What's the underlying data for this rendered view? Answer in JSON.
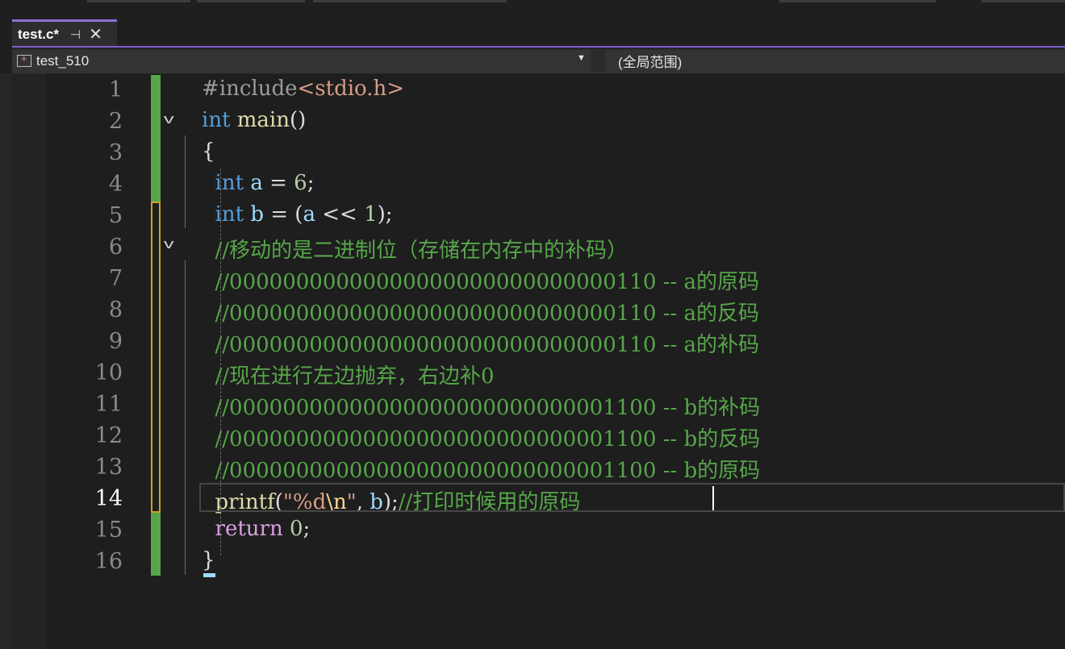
{
  "tab": {
    "title": "test.c*",
    "pin_icon": "⊣",
    "close_icon": "✕"
  },
  "nav": {
    "project": "test_510",
    "scope": "(全局范围)",
    "dropdown_icon": "▼"
  },
  "editor": {
    "current_line": 14,
    "lines": [
      {
        "n": "1"
      },
      {
        "n": "2"
      },
      {
        "n": "3"
      },
      {
        "n": "4"
      },
      {
        "n": "5"
      },
      {
        "n": "6"
      },
      {
        "n": "7"
      },
      {
        "n": "8"
      },
      {
        "n": "9"
      },
      {
        "n": "10"
      },
      {
        "n": "11"
      },
      {
        "n": "12"
      },
      {
        "n": "13"
      },
      {
        "n": "14"
      },
      {
        "n": "15"
      },
      {
        "n": "16"
      }
    ],
    "code": {
      "l1_pp": "#include",
      "l1_hdr": "<stdio.h>",
      "l2_kw": "int",
      "l2_fn": "main",
      "l2_rest": "()",
      "l3": "{",
      "l4_kw": "int",
      "l4_var": "a",
      "l4_eq": " = ",
      "l4_num": "6",
      "l4_end": ";",
      "l5_kw": "int",
      "l5_var": "b",
      "l5_eq": " = (",
      "l5_var2": "a",
      "l5_op": " << ",
      "l5_num": "1",
      "l5_end": ");",
      "l6": "//移动的是二进制位（存储在内存中的补码）",
      "l7": "//00000000000000000000000000000110 -- a的原码",
      "l8": "//00000000000000000000000000000110 -- a的反码",
      "l9": "//00000000000000000000000000000110 -- a的补码",
      "l10": "//现在进行左边抛弃，右边补0",
      "l11": "//00000000000000000000000000001100 -- b的补码",
      "l12": "//00000000000000000000000000001100 -- b的反码",
      "l13": "//00000000000000000000000000001100 -- b的原码",
      "l14_fn": "printf",
      "l14_open": "(",
      "l14_str1": "\"%d",
      "l14_esc": "\\n",
      "l14_str2": "\"",
      "l14_comma": ", ",
      "l14_var": "b",
      "l14_end": ");",
      "l14_cm": "//打印时候用的原码",
      "l15_kw": "return",
      "l15_num": "0",
      "l15_end": ";",
      "l16": "}"
    }
  }
}
